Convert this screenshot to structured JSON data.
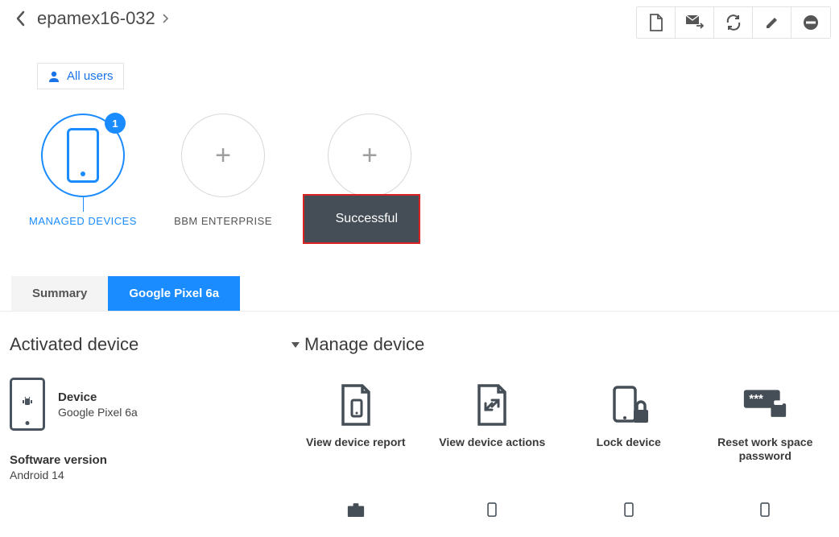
{
  "breadcrumb": {
    "title": "epamex16-032"
  },
  "allusers": {
    "label": "All users"
  },
  "circles": {
    "managed": {
      "label": "MANAGED DEVICES",
      "badge": "1"
    },
    "bbm": {
      "label": "BBM ENTERPRISE"
    }
  },
  "toast": {
    "label": "Successful"
  },
  "tabs": {
    "summary": "Summary",
    "device": "Google Pixel 6a"
  },
  "activated": {
    "title": "Activated device",
    "device_label": "Device",
    "device_model": "Google Pixel 6a",
    "software_label": "Software version",
    "software_value": "Android 14"
  },
  "manage": {
    "title": "Manage device",
    "actions": {
      "view_report": "View device report",
      "view_actions": "View device actions",
      "lock": "Lock device",
      "reset_pw": "Reset work space password"
    }
  }
}
